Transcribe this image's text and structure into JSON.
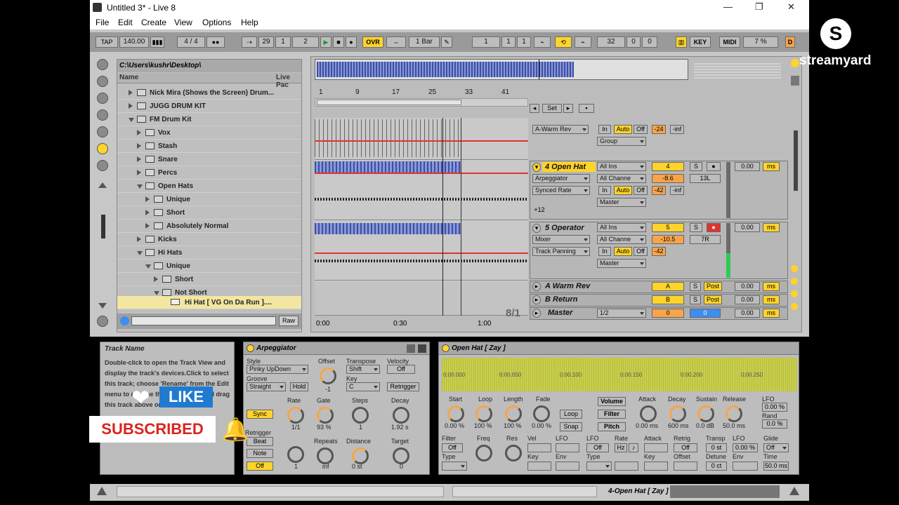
{
  "window": {
    "title": "Untitled 3* - Live 8",
    "minimize": "—",
    "maximize": "❐",
    "close": "✕"
  },
  "menu": [
    "File",
    "Edit",
    "Create",
    "View",
    "Options",
    "Help"
  ],
  "transport": {
    "tap": "TAP",
    "tempo": "140.00",
    "meter": "4 / 4",
    "position": [
      "29",
      "1",
      "2"
    ],
    "ovr": "OVR",
    "quantize": "1 Bar",
    "loop_start": [
      "1",
      "1",
      "1"
    ],
    "loop_length": [
      "32",
      "0",
      "0"
    ],
    "key": "KEY",
    "midi": "MIDI",
    "cpu": "7 %",
    "d": "D"
  },
  "browser": {
    "path": "C:\\Users\\kushr\\Desktop\\",
    "col_name": "Name",
    "col_live": "Live Pac",
    "items": [
      {
        "label": "Nick Mira (Shows the Screen) Drum...",
        "level": 1,
        "open": false
      },
      {
        "label": "JUGG DRUM KIT",
        "level": 1,
        "open": false
      },
      {
        "label": "FM Drum Kit",
        "level": 1,
        "open": true
      },
      {
        "label": "Vox",
        "level": 2,
        "open": false
      },
      {
        "label": "Stash",
        "level": 2,
        "open": false
      },
      {
        "label": "Snare",
        "level": 2,
        "open": false
      },
      {
        "label": "Percs",
        "level": 2,
        "open": false
      },
      {
        "label": "Open Hats",
        "level": 2,
        "open": true
      },
      {
        "label": "Unique",
        "level": 3,
        "open": false
      },
      {
        "label": "Short",
        "level": 3,
        "open": false
      },
      {
        "label": "Absolutely Normal",
        "level": 3,
        "open": false
      },
      {
        "label": "Kicks",
        "level": 2,
        "open": false
      },
      {
        "label": "Hi Hats",
        "level": 2,
        "open": true
      },
      {
        "label": "Unique",
        "level": 3,
        "open": true
      },
      {
        "label": "Short",
        "level": 4,
        "open": false
      },
      {
        "label": "Not Short",
        "level": 4,
        "open": true
      }
    ],
    "selected_file": "Hi Hat [ VG On Da Run ]....",
    "raw": "Raw"
  },
  "ruler": {
    "marks": [
      "1",
      "9",
      "17",
      "25",
      "33",
      "41"
    ],
    "times": [
      "0:00",
      "0:30",
      "1:00"
    ],
    "zoom": "8/1"
  },
  "tracks": {
    "set_label": "Set",
    "warm_rev_send": "A-Warm Rev",
    "group": "Group",
    "in": "In",
    "auto": "Auto",
    "off": "Off",
    "t4": {
      "name": "4 Open Hat",
      "input": "All Ins",
      "channel": "All Channe",
      "dev1": "Arpeggiator",
      "dev2": "Synced Rate",
      "out": "Master",
      "num": "4",
      "vol": "-8.6",
      "pan": "13L",
      "peak": "-42",
      "inf": "-inf",
      "delay": "0.00",
      "ms": "ms",
      "plus": "+12"
    },
    "t5": {
      "name": "5 Operator",
      "input": "All Ins",
      "channel": "All Channe",
      "dev1": "Mixer",
      "dev2": "Track Panning",
      "out": "Master",
      "num": "5",
      "vol": "-10.5",
      "pan": "7R",
      "peak": "-42",
      "delay": "0.00",
      "ms": "ms"
    },
    "top": {
      "peak": "-24",
      "inf": "-inf"
    },
    "a": {
      "name": "A Warm Rev",
      "letter": "A",
      "post": "Post",
      "delay": "0.00",
      "ms": "ms"
    },
    "b": {
      "name": "B Return",
      "letter": "B",
      "post": "Post",
      "delay": "0.00",
      "ms": "ms"
    },
    "master": {
      "name": "Master",
      "cue": "1/2",
      "num": "0",
      "num2": "0",
      "delay": "0.00",
      "ms": "ms"
    },
    "s": "S"
  },
  "info": {
    "title": "Track Name",
    "text": "Double-click to open the Track View and display the track's devices.Click to select this track; choose 'Rename' from the Edit menu to rename this track; click and drag this track above or below"
  },
  "arp": {
    "title": "Arpeggiator",
    "style_label": "Style",
    "style": "Pinky UpDown",
    "groove_label": "Groove",
    "groove": "Straight",
    "hold": "Hold",
    "offset_label": "Offset",
    "offset": "-1",
    "transpose_label": "Transpose",
    "transpose": "Shift",
    "key_label": "Key",
    "key": "C",
    "velocity_label": "Velocity",
    "velocity": "Off",
    "retrigger": "Retrigger",
    "sync": "Sync",
    "rate_label": "Rate",
    "rate": "1/1",
    "gate_label": "Gate",
    "gate": "93 %",
    "steps_label": "Steps",
    "steps": "1",
    "decay_label": "Decay",
    "decay": "1.92 s",
    "retrig_label": "Retrigger",
    "beat": "Beat",
    "note": "Note",
    "off": "Off",
    "repeats_label": "Repeats",
    "repeats": "inf",
    "distance_label": "Distance",
    "distance": "0 st",
    "target_label": "Target",
    "target": "0",
    "one": "1"
  },
  "sampler": {
    "title": "Open Hat [ Zay ]",
    "start_label": "Start",
    "start": "0.00 %",
    "loop_label": "Loop",
    "loop": "100 %",
    "length_label": "Length",
    "length": "100 %",
    "fade_label": "Fade",
    "fade": "0.00 %",
    "loop_btn": "Loop",
    "snap": "Snap",
    "volume": "Volume",
    "filter": "Filter",
    "pitch": "Pitch",
    "attack_label": "Attack",
    "attack": "0.00 ms",
    "decay_label": "Decay",
    "decay": "600 ms",
    "sustain_label": "Sustain",
    "sustain": "0.0 dB",
    "release_label": "Release",
    "release": "50.0 ms",
    "lfo_label": "LFO",
    "lfo": "0.00 %",
    "rand_label": "Rand",
    "rand": "0.0 %",
    "f_filter": "Filter",
    "f_off": "Off",
    "f_freq": "Freq",
    "f_res": "Res",
    "f_type": "Type",
    "f_vel": "Vel",
    "f_lfo": "LFO",
    "f_key": "Key",
    "f_env": "Env",
    "l_lfo": "LFO",
    "l_off": "Off",
    "l_rate": "Rate",
    "l_hz": "Hz",
    "l_type": "Type",
    "l_attack": "Attack",
    "l_retrig": "Retrig",
    "l_off2": "Off",
    "l_key": "Key",
    "l_offset": "Offset",
    "transp_label": "Transp",
    "transp": "0 st",
    "detune_label": "Detune",
    "detune": "0 ct",
    "lfo2_label": "LFO",
    "lfo2": "0.00 %",
    "env_label": "Env",
    "glide_label": "Glide",
    "glide": "Off",
    "time_label": "Time",
    "time": "50.0 ms",
    "ticks": [
      "0:00.000",
      "0:00.050",
      "0:00.100",
      "0:00.150",
      "0:00.200",
      "0:00.250"
    ]
  },
  "status": {
    "track": "4-Open Hat [ Zay ]"
  },
  "overlay": {
    "like": "LIKE",
    "subscribed": "SUBSCRIBED",
    "brand": "streamyard",
    "brand_initial": "S"
  },
  "colors": {
    "accent": "#ffd42a",
    "orange": "#f8a44a",
    "clip_blue": "#3b4fa8",
    "red": "#e2322d"
  }
}
